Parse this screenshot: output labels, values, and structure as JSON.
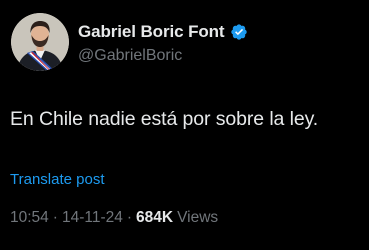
{
  "author": {
    "display_name": "Gabriel Boric Font",
    "handle": "@GabrielBoric",
    "avatar_icon": "avatar-photo-icon",
    "verified_icon": "verified-badge-icon",
    "verified_color": "#1d9bf0"
  },
  "post": {
    "text": "En Chile nadie está por sobre la ley.",
    "translate_label": "Translate post"
  },
  "meta": {
    "time": "10:54",
    "separator": "·",
    "date": "14-11-24",
    "views_count": "684K",
    "views_label": "Views"
  },
  "colors": {
    "background": "#000000",
    "primary_text": "#e7e9ea",
    "secondary_text": "#71767b",
    "link": "#1d9bf0"
  }
}
